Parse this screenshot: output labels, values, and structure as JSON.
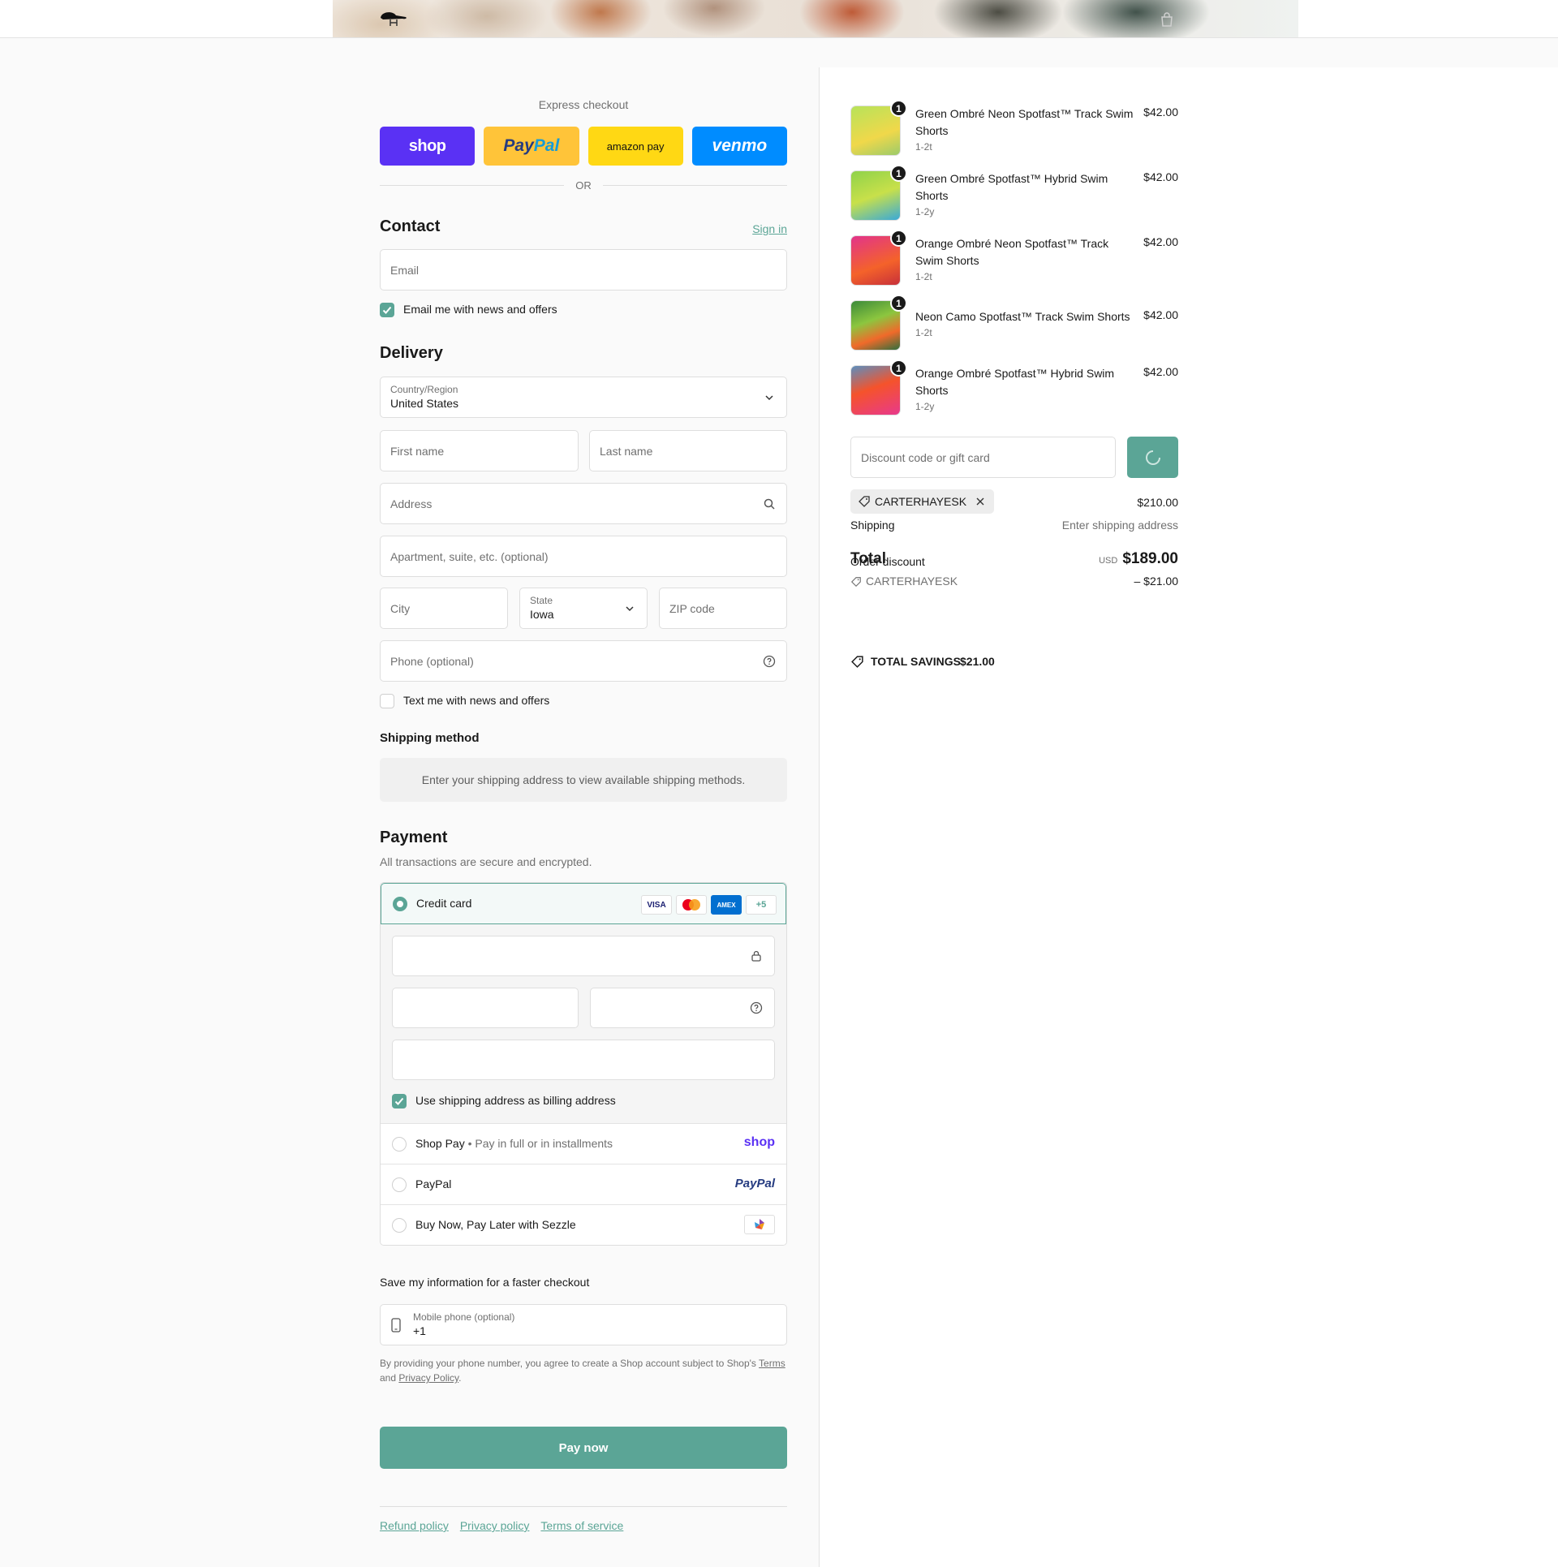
{
  "header": {
    "logo_icon": "hat-logo-icon",
    "cart_icon": "shopping-bag-icon"
  },
  "express": {
    "title": "Express checkout",
    "shop_label": "shop",
    "paypal_label_1": "Pay",
    "paypal_label_2": "Pal",
    "amazon_label": "amazon pay",
    "venmo_label": "venmo",
    "or_label": "OR"
  },
  "contact": {
    "title": "Contact",
    "sign_in": "Sign in",
    "email_placeholder": "Email",
    "email_news_label": "Email me with news and offers",
    "email_news_checked": true
  },
  "delivery": {
    "title": "Delivery",
    "country_label": "Country/Region",
    "country_value": "United States",
    "first_name_placeholder": "First name",
    "last_name_placeholder": "Last name",
    "address_placeholder": "Address",
    "apartment_placeholder": "Apartment, suite, etc. (optional)",
    "city_placeholder": "City",
    "state_label": "State",
    "state_value": "Iowa",
    "zip_placeholder": "ZIP code",
    "phone_placeholder": "Phone (optional)",
    "text_news_label": "Text me with news and offers",
    "text_news_checked": false
  },
  "shipping_method": {
    "title": "Shipping method",
    "message": "Enter your shipping address to view available shipping methods."
  },
  "payment": {
    "title": "Payment",
    "subtitle": "All transactions are secure and encrypted.",
    "credit_card_label": "Credit card",
    "card_badges": [
      "VISA",
      "MC",
      "AMEX",
      "+5"
    ],
    "billing_same_label": "Use shipping address as billing address",
    "billing_same_checked": true,
    "options": [
      {
        "label": "Shop Pay",
        "sub": "Pay in full or in installments",
        "logo": "shop"
      },
      {
        "label": "PayPal",
        "sub": "",
        "logo": "PayPal"
      },
      {
        "label": "Buy Now, Pay Later with Sezzle",
        "sub": "",
        "logo": "sezzle-icon"
      }
    ]
  },
  "save_info": {
    "title": "Save my information for a faster checkout",
    "mobile_label": "Mobile phone (optional)",
    "mobile_value": "+1",
    "legal_1": "By providing your phone number, you agree to create a Shop account subject to Shop's ",
    "terms": "Terms",
    "legal_2": "and ",
    "privacy": "Privacy Policy",
    "legal_3": "."
  },
  "pay_now_label": "Pay now",
  "footer": {
    "links": [
      "Refund policy",
      "Privacy policy",
      "Terms of service"
    ]
  },
  "summary": {
    "items": [
      {
        "name": "Green Ombré Neon Spotfast™ Track Swim Shorts",
        "variant": "1-2t",
        "price": "$42.00",
        "qty": "1",
        "colors": [
          "#b7e35a",
          "#f0d84a"
        ]
      },
      {
        "name": "Green Ombré Spotfast™ Hybrid Swim Shorts",
        "variant": "1-2y",
        "price": "$42.00",
        "qty": "1",
        "colors": [
          "#8fd24b",
          "#3aa9d8"
        ]
      },
      {
        "name": "Orange Ombré Neon Spotfast™ Track Swim Shorts",
        "variant": "1-2t",
        "price": "$42.00",
        "qty": "1",
        "colors": [
          "#e2348b",
          "#f4622a"
        ]
      },
      {
        "name": "Neon Camo Spotfast™ Track Swim Shorts",
        "variant": "1-2t",
        "price": "$42.00",
        "qty": "1",
        "colors": [
          "#3c8a3a",
          "#f06a2a"
        ]
      },
      {
        "name": "Orange Ombré Spotfast™ Hybrid Swim Shorts",
        "variant": "1-2y",
        "price": "$42.00",
        "qty": "1",
        "colors": [
          "#f5532b",
          "#e8398c"
        ]
      }
    ],
    "discount_placeholder": "Discount code or gift card",
    "applied_code": "CARTERHAYESK",
    "subtotal": "$210.00",
    "shipping_label": "Shipping",
    "shipping_value": "Enter shipping address",
    "order_discount_label": "Order discount",
    "total_label": "Total",
    "currency": "USD",
    "total_value": "$189.00",
    "discount_code": "CARTERHAYESK",
    "discount_value": "– $21.00",
    "savings_label": "TOTAL SAVINGS",
    "savings_value": "$21.00"
  },
  "colors": {
    "accent": "#5ba596",
    "shop_purple": "#5a31f4",
    "paypal_yellow": "#ffc439",
    "amazon_yellow": "#ffd814",
    "venmo_blue": "#008cff"
  }
}
